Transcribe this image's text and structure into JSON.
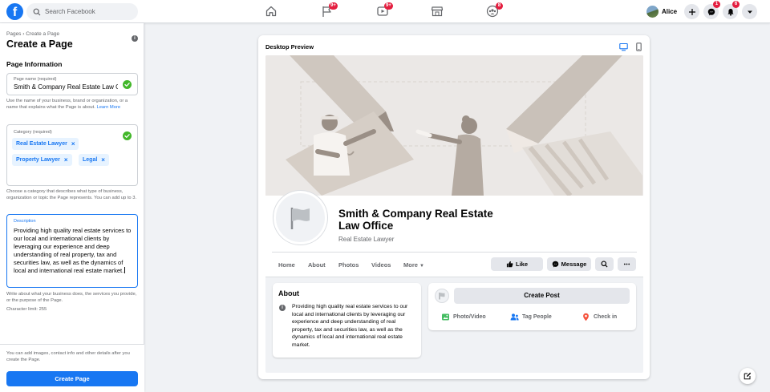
{
  "header": {
    "logo": "f",
    "search": {
      "placeholder": "Search Facebook"
    },
    "nav": [
      {
        "icon": "home-icon",
        "badge": ""
      },
      {
        "icon": "flag-icon",
        "badge": "9+"
      },
      {
        "icon": "video-icon",
        "badge": "9+"
      },
      {
        "icon": "marketplace-icon",
        "badge": ""
      },
      {
        "icon": "groups-icon",
        "badge": "8"
      }
    ],
    "profile_name": "Alice",
    "messenger_badge": "1",
    "notifications_badge": "6"
  },
  "left": {
    "breadcrumb": "Pages › Create a Page",
    "title": "Create a Page",
    "section": "Page Information",
    "page_name": {
      "label": "Page name (required)",
      "value": "Smith & Company Real Estate Law Office",
      "help": "Use the name of your business, brand or organization, or a name that explains what the Page is about.",
      "learn_more": "Learn More"
    },
    "category": {
      "label": "Category (required)",
      "chips": [
        "Real Estate Lawyer",
        "Property Lawyer",
        "Legal"
      ],
      "help": "Choose a category that describes what type of business, organization or topic the Page represents. You can add up to 3."
    },
    "description": {
      "label": "Description",
      "value": "Providing high quality real estate services to our local and international clients by leveraging our experience and deep understanding of real property, tax and securities law, as well as the dynamics of local and international real estate market.",
      "help": "Write about what your business does, the services you provide, or the purpose of the Page.",
      "limit": "Character limit: 255"
    },
    "footer_text": "You can add images, contact info and other details after you create the Page.",
    "create_button": "Create Page"
  },
  "preview": {
    "title": "Desktop Preview",
    "page_name": "Smith & Company Real Estate Law Office",
    "category": "Real Estate Lawyer",
    "tabs": [
      "Home",
      "About",
      "Photos",
      "Videos",
      "More"
    ],
    "like_button": "Like",
    "message_button": "Message",
    "about_title": "About",
    "about_text": "Providing high quality real estate services to our local and international clients by leveraging our experience and deep understanding of real property, tax and securities law, as well as the dynamics of local and international real estate market.",
    "create_post": "Create Post",
    "actions": [
      "Photo/Video",
      "Tag People",
      "Check in"
    ]
  },
  "colors": {
    "accent": "#1877f2",
    "badge": "#e41e3f",
    "success": "#42b72a"
  }
}
